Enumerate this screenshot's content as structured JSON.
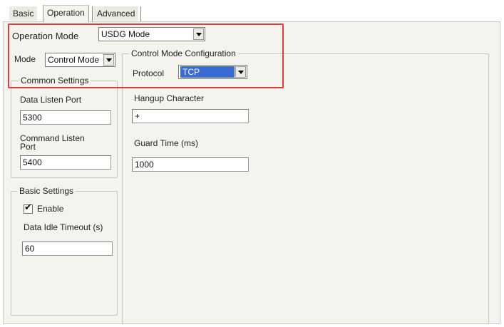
{
  "tabs": [
    {
      "label": "Basic",
      "active": false
    },
    {
      "label": "Operation",
      "active": true
    },
    {
      "label": "Advanced",
      "active": false
    }
  ],
  "operation_mode": {
    "label": "Operation Mode",
    "value": "USDG Mode"
  },
  "mode": {
    "label": "Mode",
    "value": "Control Mode"
  },
  "common_settings": {
    "title": "Common Settings",
    "data_listen_port": {
      "label": "Data Listen Port",
      "value": "5300"
    },
    "command_listen_port": {
      "label_line1": "Command Listen",
      "label_line2": "Port",
      "value": "5400"
    }
  },
  "basic_settings": {
    "title": "Basic Settings",
    "enable": {
      "label": "Enable",
      "checked": true
    },
    "data_idle_timeout": {
      "label": "Data Idle Timeout (s)",
      "value": "60"
    }
  },
  "control_mode_config": {
    "title": "Control Mode Configuration",
    "protocol": {
      "label": "Protocol",
      "value": "TCP"
    },
    "hangup_character": {
      "label": "Hangup Character",
      "value": "+"
    },
    "guard_time": {
      "label": "Guard Time (ms)",
      "value": "1000"
    }
  },
  "colors": {
    "highlight_box": "#e23a3a",
    "selection": "#3a6bd3",
    "panel_bg": "#f4f3ee"
  }
}
